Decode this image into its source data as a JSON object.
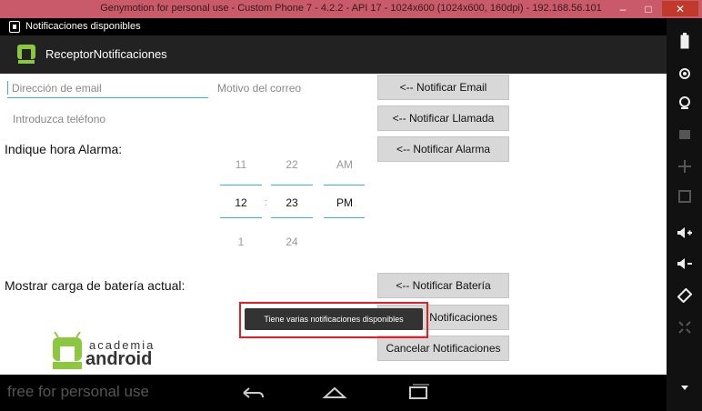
{
  "window": {
    "title": "Genymotion for personal use - Custom Phone 7 - 4.2.2 - API 17 - 1024x600 (1024x600, 160dpi) - 192.168.56.101",
    "controls": [
      "–",
      "□",
      "✕"
    ]
  },
  "status_bar": {
    "notification_text": "Notificaciones disponibles"
  },
  "action_bar": {
    "title": "ReceptorNotificaciones"
  },
  "form": {
    "email_placeholder": "Dirección de email",
    "subject_placeholder": "Motivo del correo",
    "phone_placeholder": "Introduzca teléfono",
    "alarm_label": "Indique hora Alarma:",
    "battery_label": "Mostrar carga de batería actual:"
  },
  "buttons": {
    "email": "<-- Notificar Email",
    "call": "<-- Notificar Llamada",
    "alarm": "<-- Notificar Alarma",
    "battery": "<-- Notificar Batería",
    "notifications_partial": "Notificaciones",
    "cancel": "Cancelar Notificaciones"
  },
  "time_picker": {
    "hour": {
      "prev": "11",
      "current": "12",
      "next": "1"
    },
    "minute": {
      "prev": "22",
      "current": "23",
      "next": "24"
    },
    "ampm": {
      "prev": "AM",
      "current": "PM"
    },
    "separator": ":"
  },
  "toast": {
    "text": "Tiene varias notificaciones disponibles"
  },
  "logo": {
    "line1": "academia",
    "line2": "android"
  },
  "nav": {
    "watermark": "free for personal use"
  },
  "colors": {
    "accent": "#3ab1d8",
    "highlight": "#e31e24",
    "logo_green": "#8dc63f"
  }
}
